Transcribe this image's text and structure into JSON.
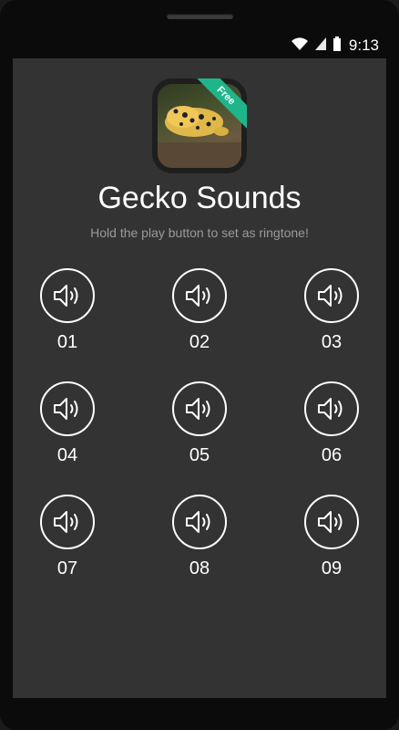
{
  "status": {
    "time": "9:13",
    "icons": [
      "wifi-icon",
      "signal-icon",
      "battery-icon"
    ]
  },
  "app": {
    "badge": "Free",
    "title": "Gecko Sounds",
    "subtitle": "Hold the play button to set as ringtone!"
  },
  "sounds": [
    {
      "label": "01"
    },
    {
      "label": "02"
    },
    {
      "label": "03"
    },
    {
      "label": "04"
    },
    {
      "label": "05"
    },
    {
      "label": "06"
    },
    {
      "label": "07"
    },
    {
      "label": "08"
    },
    {
      "label": "09"
    }
  ],
  "colors": {
    "screen_bg": "#333333",
    "accent_ribbon": "#1fb58a",
    "text": "#ffffff",
    "subtitle": "#9a9a9a"
  }
}
